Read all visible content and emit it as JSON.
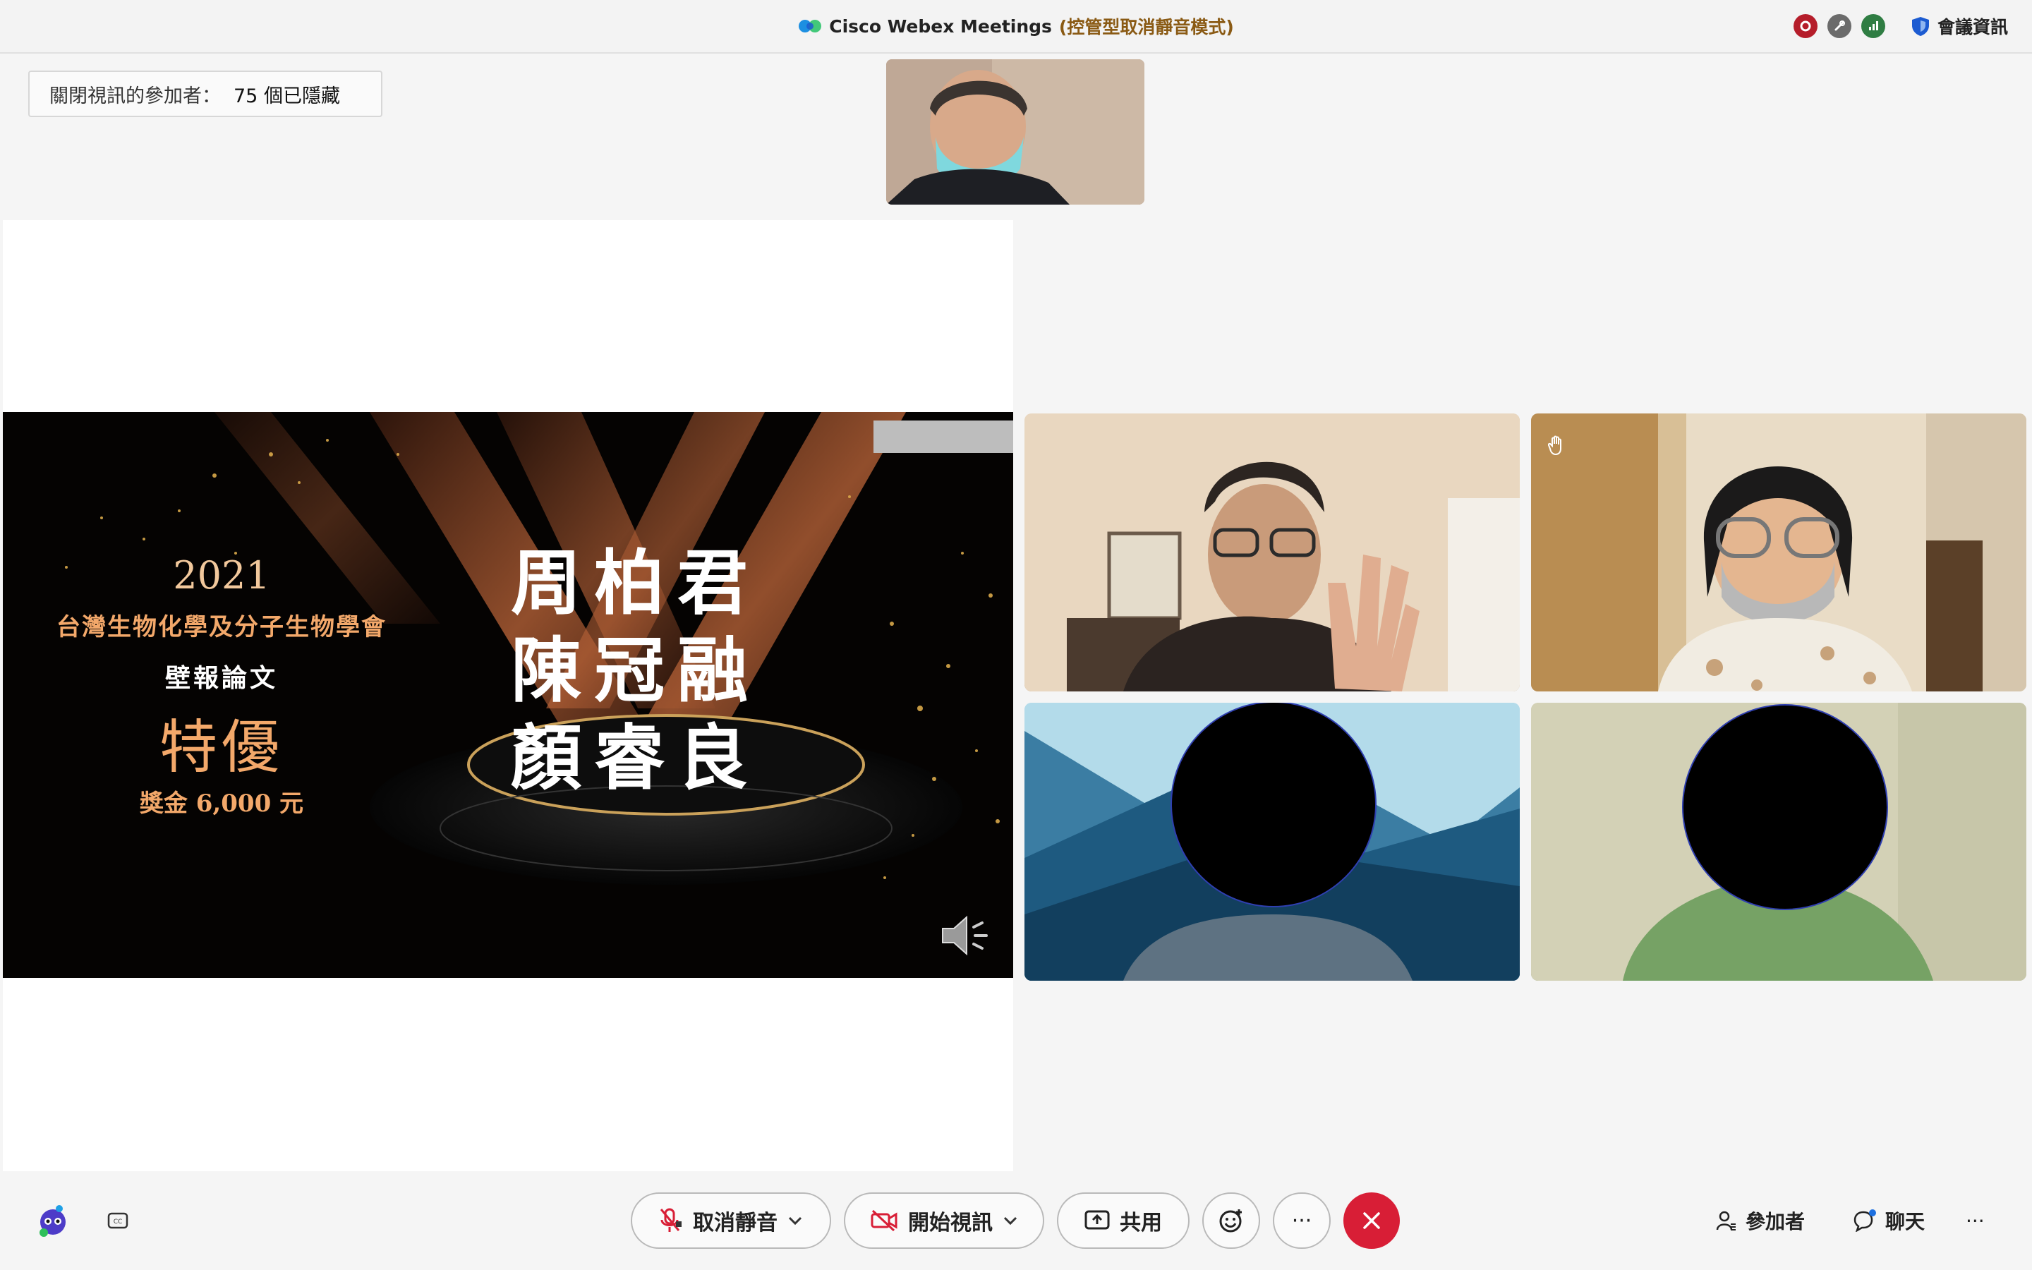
{
  "titlebar": {
    "app_name": "Cisco Webex Meetings",
    "mode": "(控管型取消靜音模式)",
    "meeting_info_label": "會議資訊"
  },
  "hidden_participants": {
    "label": "關閉視訊的參加者：",
    "count": "75 個已隱藏"
  },
  "slide": {
    "year": "2021",
    "society": "台灣生物化學及分子生物學會",
    "category": "壁報論文",
    "award": "特優",
    "prize": "獎金 6,000 元",
    "names": [
      "周柏君",
      "陳冠融",
      "顏睿良"
    ]
  },
  "controls": {
    "unmute": "取消靜音",
    "start_video": "開始視訊",
    "share": "共用",
    "more": "···",
    "participants": "參加者",
    "chat": "聊天",
    "overflow": "···"
  },
  "colors": {
    "leave_red": "#d81e36",
    "mode_text": "#8a5a14",
    "slide_gold": "#f3a86a"
  },
  "icons": [
    "webex-logo-icon",
    "record-icon",
    "link-icon",
    "signal-icon",
    "shield-icon",
    "assistant-icon",
    "cc-icon",
    "mic-muted-icon",
    "video-off-icon",
    "share-screen-icon",
    "reaction-icon",
    "close-icon",
    "person-icon",
    "chat-bubble-icon",
    "raise-hand-icon",
    "speaker-icon"
  ]
}
